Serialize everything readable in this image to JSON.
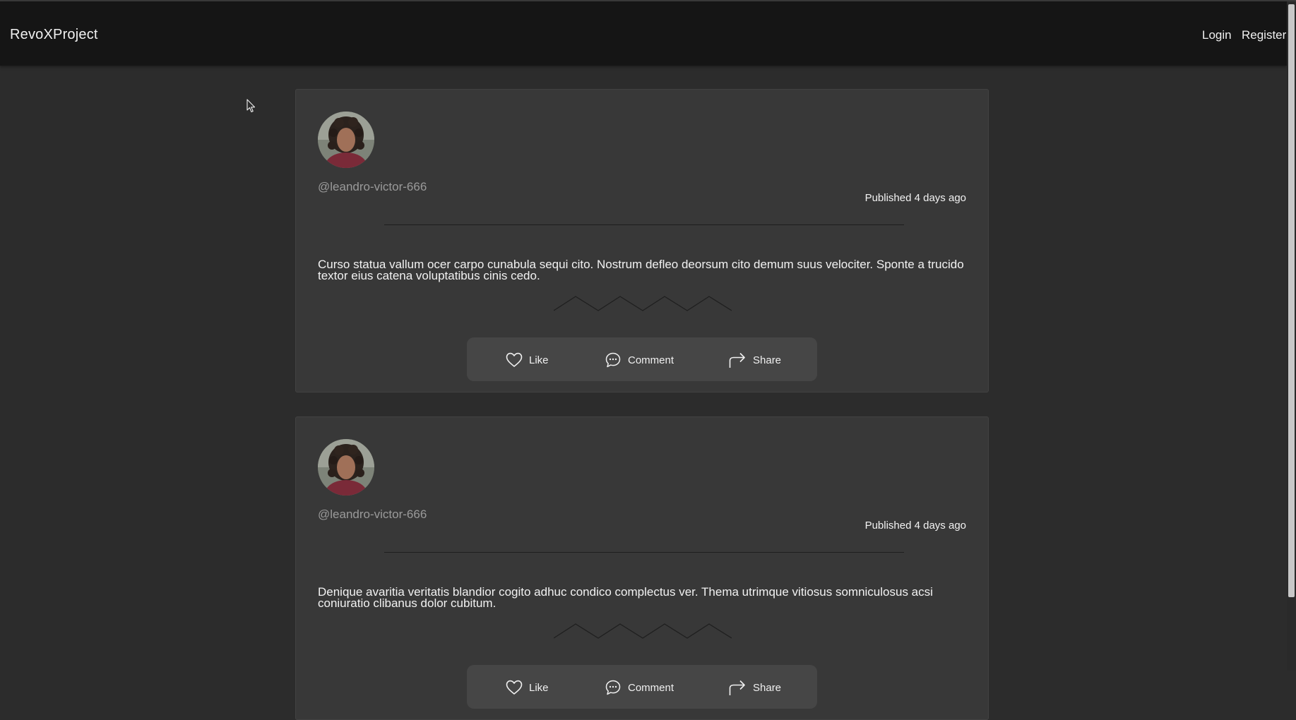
{
  "navbar": {
    "brand": "RevoXProject",
    "links": [
      "Login",
      "Register"
    ]
  },
  "posts": [
    {
      "author": "@leandro-victor-666",
      "published": "Published 4 days ago",
      "text": "Curso statua vallum ocer carpo cunabula sequi cito. Nostrum defleo deorsum cito demum suus velociter. Sponte a trucido textor eius catena voluptatibus cinis cedo.",
      "actions": {
        "like": "Like",
        "comment": "Comment",
        "share": "Share"
      }
    },
    {
      "author": "@leandro-victor-666",
      "published": "Published 4 days ago",
      "text": "Denique avaritia veritatis blandior cogito adhuc condico complectus ver. Thema utrimque vitiosus somniculosus acsi coniuratio clibanus dolor cubitum.",
      "actions": {
        "like": "Like",
        "comment": "Comment",
        "share": "Share"
      }
    }
  ],
  "icons": {
    "like": "heart-icon",
    "comment": "comment-bubble-icon",
    "share": "share-arrow-icon"
  },
  "colors": {
    "background": "#2c2c2c",
    "navbar": "#151515",
    "card": "#383838",
    "action_bar": "#464646",
    "author": "#9a9a9a"
  }
}
